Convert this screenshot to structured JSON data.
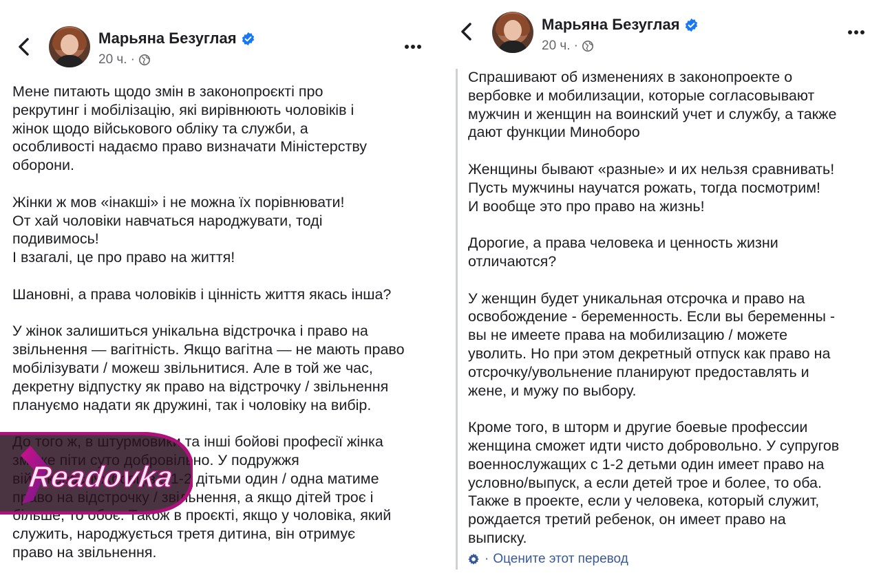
{
  "left": {
    "author": "Марьяна Безуглая",
    "time": "20 ч.",
    "separator": "·",
    "body": "Мене питають щодо змін в законопроєкті про\nрекрутинг і мобілізацію, які вирівнюють чоловіків і\nжінок щодо військового обліку та служби, а\nособливості надаємо право визначати Міністерству\nоборони.\n\nЖінки ж мов «інакші» і не можна їх порівнювати!\nОт хай чоловіки навчаться народжувати, тоді\nподивимось!\nІ взагалі, це про право на життя!\n\nШановні, а права чоловіків і цінність життя якась інша?\n\nУ жінок залишиться унікальна відстрочка і право на\nзвільнення — вагітність. Якщо вагітна — не мають право\nмобілізувати / можеш звільнитися. Але в той же час,\nдекретну відпустку як право на відстрочку / звільнення\nплануємо надати як дружині, так і чоловіку на вибір.\n\nДо того ж, в штурмовики та інші бойові професії жінка\nзможе піти суто добровільно. У подружжя\nвійськовослужбовців з 1-2 дітьми один / одна матиме\nправо на відстрочку / звільнення, а якщо дітей троє і\nбільше, то обоє. Також в проєкті, якщо у чоловіка, який\nслужить, народжується третя дитина, він отримує\nправо на звільнення."
  },
  "right": {
    "author": "Марьяна Безуглая",
    "time": "20 ч.",
    "separator": "·",
    "body": "Спрашивают об изменениях в законопроекте о\nвербовке и мобилизации, которые согласовывают\nмужчин и женщин на воинский учет и службу, а также\nдают функции Миноборо\n\nЖенщины бывают «разные» и их нельзя сравнивать!\nПусть мужчины научатся рожать, тогда посмотрим!\nИ вообще это про право на жизнь!\n\nДорогие, а права человека и ценность жизни\nотличаются?\n\nУ женщин будет уникальная отсрочка и право на\nосвобождение - беременность. Если вы беременны -\nвы не имеете права на мобилизацию / можете\nуволить. Но при этом декретный отпуск как право на\nотсрочку/увольнение планируют предоставлять и\nжене, и мужу по выбору.\n\nКроме того, в шторм и другие боевые профессии\nженщина сможет идти чисто добровольно. У супругов\nвоеннослужащих с 1-2 детьми один имеет право на\nусловно/выпуск, а если детей трое и более, то оба.\nТакже в проекте, если у человека, который служит,\nрождается третий ребенок, он имеет право на\nвыписку.",
    "translate_separator": "·",
    "rate_translation": "Оцените этот перевод"
  },
  "watermark": "Readovka",
  "colors": {
    "verified": "#1877f2",
    "link": "#385898",
    "meta": "#65676b",
    "watermark_bg": "#2a1020",
    "watermark_accent": "#b0107a"
  }
}
